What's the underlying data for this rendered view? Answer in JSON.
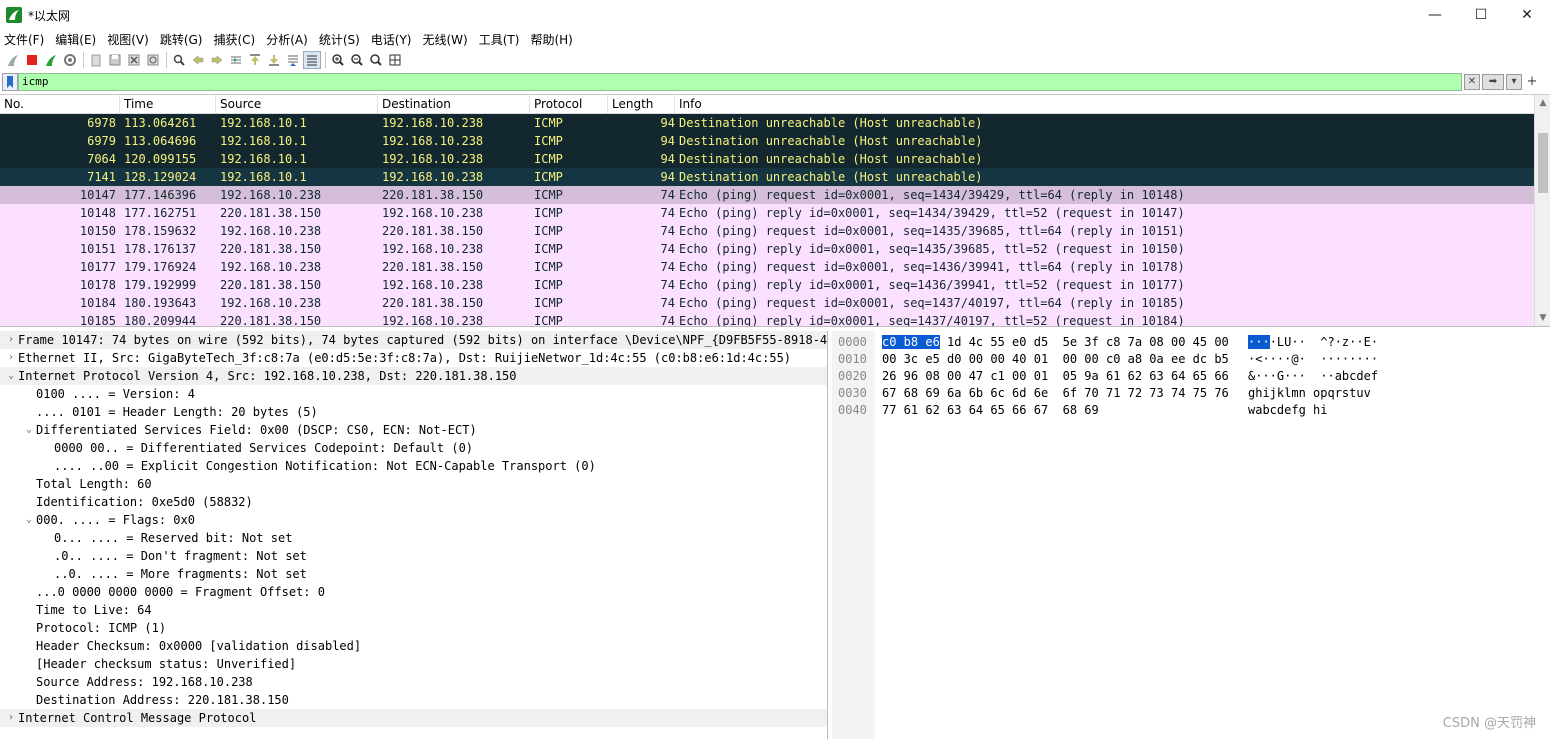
{
  "window": {
    "title": "*以太网",
    "controls": {
      "minimize": "—",
      "maximize": "☐",
      "close": "✕"
    }
  },
  "menu": [
    "文件(F)",
    "编辑(E)",
    "视图(V)",
    "跳转(G)",
    "捕获(C)",
    "分析(A)",
    "统计(S)",
    "电话(Y)",
    "无线(W)",
    "工具(T)",
    "帮助(H)"
  ],
  "filter": {
    "value": "icmp",
    "accent": "#afffaf"
  },
  "packet_list": {
    "columns": [
      "No.",
      "Time",
      "Source",
      "Destination",
      "Protocol",
      "Length",
      "Info"
    ],
    "rows": [
      {
        "no": "6978",
        "time": "113.064261",
        "src": "192.168.10.1",
        "dst": "192.168.10.238",
        "proto": "ICMP",
        "len": "94",
        "info": "Destination unreachable (Host unreachable)",
        "kind": "unreach"
      },
      {
        "no": "6979",
        "time": "113.064696",
        "src": "192.168.10.1",
        "dst": "192.168.10.238",
        "proto": "ICMP",
        "len": "94",
        "info": "Destination unreachable (Host unreachable)",
        "kind": "unreach"
      },
      {
        "no": "7064",
        "time": "120.099155",
        "src": "192.168.10.1",
        "dst": "192.168.10.238",
        "proto": "ICMP",
        "len": "94",
        "info": "Destination unreachable (Host unreachable)",
        "kind": "unreach"
      },
      {
        "no": "7141",
        "time": "128.129024",
        "src": "192.168.10.1",
        "dst": "192.168.10.238",
        "proto": "ICMP",
        "len": "94",
        "info": "Destination unreachable (Host unreachable)",
        "kind": "unreach sel"
      },
      {
        "no": "10147",
        "time": "177.146396",
        "src": "192.168.10.238",
        "dst": "220.181.38.150",
        "proto": "ICMP",
        "len": "74",
        "info": "Echo (ping) request  id=0x0001, seq=1434/39429, ttl=64 (reply in 10148)",
        "kind": "echo cur"
      },
      {
        "no": "10148",
        "time": "177.162751",
        "src": "220.181.38.150",
        "dst": "192.168.10.238",
        "proto": "ICMP",
        "len": "74",
        "info": "Echo (ping) reply    id=0x0001, seq=1434/39429, ttl=52 (request in 10147)",
        "kind": "echo"
      },
      {
        "no": "10150",
        "time": "178.159632",
        "src": "192.168.10.238",
        "dst": "220.181.38.150",
        "proto": "ICMP",
        "len": "74",
        "info": "Echo (ping) request  id=0x0001, seq=1435/39685, ttl=64 (reply in 10151)",
        "kind": "echo"
      },
      {
        "no": "10151",
        "time": "178.176137",
        "src": "220.181.38.150",
        "dst": "192.168.10.238",
        "proto": "ICMP",
        "len": "74",
        "info": "Echo (ping) reply    id=0x0001, seq=1435/39685, ttl=52 (request in 10150)",
        "kind": "echo"
      },
      {
        "no": "10177",
        "time": "179.176924",
        "src": "192.168.10.238",
        "dst": "220.181.38.150",
        "proto": "ICMP",
        "len": "74",
        "info": "Echo (ping) request  id=0x0001, seq=1436/39941, ttl=64 (reply in 10178)",
        "kind": "echo"
      },
      {
        "no": "10178",
        "time": "179.192999",
        "src": "220.181.38.150",
        "dst": "192.168.10.238",
        "proto": "ICMP",
        "len": "74",
        "info": "Echo (ping) reply    id=0x0001, seq=1436/39941, ttl=52 (request in 10177)",
        "kind": "echo"
      },
      {
        "no": "10184",
        "time": "180.193643",
        "src": "192.168.10.238",
        "dst": "220.181.38.150",
        "proto": "ICMP",
        "len": "74",
        "info": "Echo (ping) request  id=0x0001, seq=1437/40197, ttl=64 (reply in 10185)",
        "kind": "echo"
      },
      {
        "no": "10185",
        "time": "180.209944",
        "src": "220.181.38.150",
        "dst": "192.168.10.238",
        "proto": "ICMP",
        "len": "74",
        "info": "Echo (ping) reply    id=0x0001, seq=1437/40197, ttl=52 (request in 10184)",
        "kind": "echo"
      }
    ]
  },
  "details": [
    {
      "arrow": "›",
      "indent": 0,
      "text": "Frame 10147: 74 bytes on wire (592 bits), 74 bytes captured (592 bits) on interface \\Device\\NPF_{D9FB5F55-8918-4",
      "shade": true
    },
    {
      "arrow": "›",
      "indent": 0,
      "text": "Ethernet II, Src: GigaByteTech_3f:c8:7a (e0:d5:5e:3f:c8:7a), Dst: RuijieNetwor_1d:4c:55 (c0:b8:e6:1d:4c:55)",
      "shade": false
    },
    {
      "arrow": "⌄",
      "indent": 0,
      "text": "Internet Protocol Version 4, Src: 192.168.10.238, Dst: 220.181.38.150",
      "shade": true
    },
    {
      "arrow": "",
      "indent": 1,
      "text": "0100 .... = Version: 4",
      "shade": false
    },
    {
      "arrow": "",
      "indent": 1,
      "text": ".... 0101 = Header Length: 20 bytes (5)",
      "shade": false
    },
    {
      "arrow": "⌄",
      "indent": 1,
      "text": "Differentiated Services Field: 0x00 (DSCP: CS0, ECN: Not-ECT)",
      "shade": false
    },
    {
      "arrow": "",
      "indent": 2,
      "text": "0000 00.. = Differentiated Services Codepoint: Default (0)",
      "shade": false
    },
    {
      "arrow": "",
      "indent": 2,
      "text": ".... ..00 = Explicit Congestion Notification: Not ECN-Capable Transport (0)",
      "shade": false
    },
    {
      "arrow": "",
      "indent": 1,
      "text": "Total Length: 60",
      "shade": false
    },
    {
      "arrow": "",
      "indent": 1,
      "text": "Identification: 0xe5d0 (58832)",
      "shade": false
    },
    {
      "arrow": "⌄",
      "indent": 1,
      "text": "000. .... = Flags: 0x0",
      "shade": false
    },
    {
      "arrow": "",
      "indent": 2,
      "text": "0... .... = Reserved bit: Not set",
      "shade": false
    },
    {
      "arrow": "",
      "indent": 2,
      "text": ".0.. .... = Don't fragment: Not set",
      "shade": false
    },
    {
      "arrow": "",
      "indent": 2,
      "text": "..0. .... = More fragments: Not set",
      "shade": false
    },
    {
      "arrow": "",
      "indent": 1,
      "text": "...0 0000 0000 0000 = Fragment Offset: 0",
      "shade": false
    },
    {
      "arrow": "",
      "indent": 1,
      "text": "Time to Live: 64",
      "shade": false
    },
    {
      "arrow": "",
      "indent": 1,
      "text": "Protocol: ICMP (1)",
      "shade": false
    },
    {
      "arrow": "",
      "indent": 1,
      "text": "Header Checksum: 0x0000 [validation disabled]",
      "shade": false
    },
    {
      "arrow": "",
      "indent": 1,
      "text": "[Header checksum status: Unverified]",
      "shade": false
    },
    {
      "arrow": "",
      "indent": 1,
      "text": "Source Address: 192.168.10.238",
      "shade": false
    },
    {
      "arrow": "",
      "indent": 1,
      "text": "Destination Address: 220.181.38.150",
      "shade": false
    },
    {
      "arrow": "›",
      "indent": 0,
      "text": "Internet Control Message Protocol",
      "shade": true
    }
  ],
  "bytes": [
    {
      "offset": "0000",
      "hex_hl": "c0 b8 e6",
      "hex_rest": " 1d 4c 55 e0 d5  5e 3f c8 7a 08 00 45 00",
      "ascii_hl": "···",
      "ascii_rest": "·LU··  ^?·z··E·"
    },
    {
      "offset": "0010",
      "hex_hl": "",
      "hex_rest": "00 3c e5 d0 00 00 40 01  00 00 c0 a8 0a ee dc b5",
      "ascii_hl": "",
      "ascii_rest": "·<····@·  ········"
    },
    {
      "offset": "0020",
      "hex_hl": "",
      "hex_rest": "26 96 08 00 47 c1 00 01  05 9a 61 62 63 64 65 66",
      "ascii_hl": "",
      "ascii_rest": "&···G···  ··abcdef"
    },
    {
      "offset": "0030",
      "hex_hl": "",
      "hex_rest": "67 68 69 6a 6b 6c 6d 6e  6f 70 71 72 73 74 75 76",
      "ascii_hl": "",
      "ascii_rest": "ghijklmn opqrstuv"
    },
    {
      "offset": "0040",
      "hex_hl": "",
      "hex_rest": "77 61 62 63 64 65 66 67  68 69",
      "ascii_hl": "",
      "ascii_rest": "wabcdefg hi"
    }
  ],
  "watermark": "CSDN @天罚神",
  "colors": {
    "unreach_bg": "#12272e",
    "unreach_fg": "#f7f27e",
    "echo_bg": "#fce0ff",
    "echo_selected_bg": "#d5bfd8",
    "byte_highlight": "#0a5ad2"
  }
}
